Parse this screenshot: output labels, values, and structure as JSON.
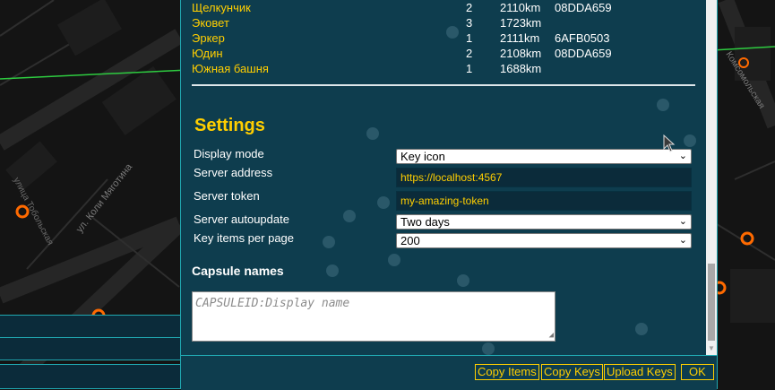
{
  "keys": [
    {
      "name": "Щелкунчик",
      "count": "2",
      "distance": "2110km",
      "capsule": "08DDA659"
    },
    {
      "name": "Эковет",
      "count": "3",
      "distance": "1723km",
      "capsule": ""
    },
    {
      "name": "Эркер",
      "count": "1",
      "distance": "2111km",
      "capsule": "6AFB0503"
    },
    {
      "name": "Юдин",
      "count": "2",
      "distance": "2108km",
      "capsule": "08DDA659"
    },
    {
      "name": "Южная башня",
      "count": "1",
      "distance": "1688km",
      "capsule": ""
    }
  ],
  "settings": {
    "title": "Settings",
    "display_mode_label": "Display mode",
    "display_mode_value": "Key icon",
    "server_address_label": "Server address",
    "server_address_value": "https://localhost:4567",
    "server_token_label": "Server token",
    "server_token_value": "my-amazing-token",
    "server_autoupdate_label": "Server autoupdate",
    "server_autoupdate_value": "Two days",
    "key_items_label": "Key items per page",
    "key_items_value": "200"
  },
  "capsule_names": {
    "title": "Capsule names",
    "placeholder": "CAPSULEID:Display name"
  },
  "buttons": {
    "copy_items": "Copy Items",
    "copy_keys": "Copy Keys",
    "upload_keys": "Upload Keys",
    "ok": "OK"
  },
  "map": {
    "street_1": "ул. Коли Мяготина",
    "street_2": "улица Тобольская",
    "street_3": "Комсомольская"
  },
  "colors": {
    "accent": "#ffce00",
    "border": "#20a8b1",
    "dialog_bg": "#0e3d4e",
    "map_bg": "#141414",
    "link_line": "#2ecc40",
    "portal": "#ff6a00"
  }
}
